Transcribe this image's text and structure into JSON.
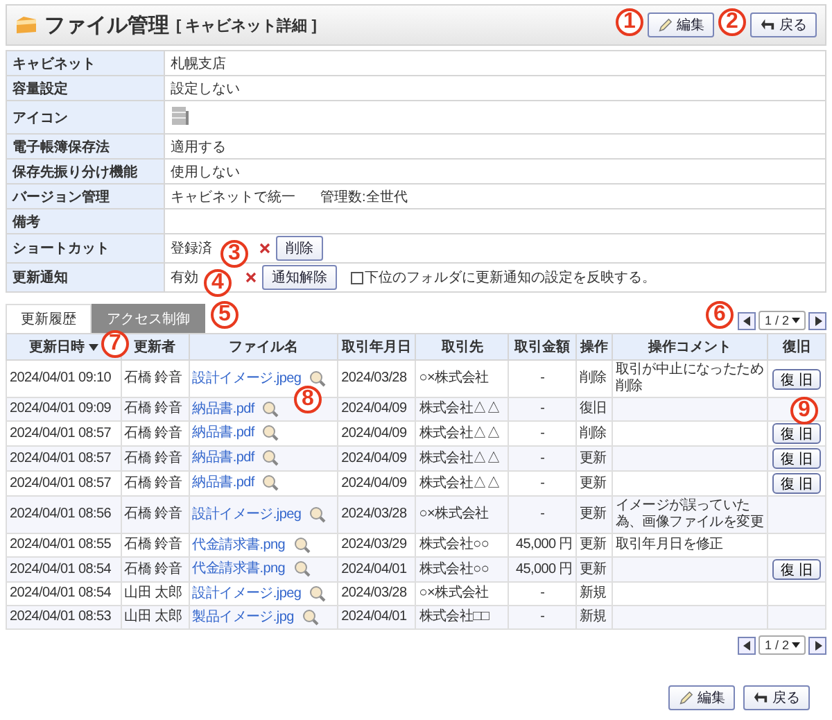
{
  "header": {
    "title": "ファイル管理",
    "subtitle": "[ キャビネット詳細 ]",
    "buttons": [
      {
        "kind": "edit",
        "label": "編集"
      },
      {
        "kind": "back",
        "label": "戻る"
      }
    ]
  },
  "details": [
    {
      "kind": "text",
      "label": "キャビネット",
      "value": "札幌支店"
    },
    {
      "kind": "text",
      "label": "容量設定",
      "value": "設定しない"
    },
    {
      "kind": "icon",
      "label": "アイコン"
    },
    {
      "kind": "text",
      "label": "電子帳簿保存法",
      "value": "適用する"
    },
    {
      "kind": "text",
      "label": "保存先振り分け機能",
      "value": "使用しない"
    },
    {
      "kind": "version",
      "label": "バージョン管理",
      "value": "キャビネットで統一",
      "extra": "管理数:全世代"
    },
    {
      "kind": "text",
      "label": "備考"
    },
    {
      "kind": "action",
      "label": "ショートカット",
      "value": "登録済",
      "button": "削除"
    },
    {
      "kind": "action",
      "label": "更新通知",
      "value": "有効",
      "button": "通知解除",
      "checkbox": {
        "label": "下位のフォルダに更新通知の設定を反映する。",
        "checked": false
      }
    }
  ],
  "tabs": [
    {
      "label": "更新履歴",
      "selected": true
    },
    {
      "label": "アクセス制御",
      "selected": false
    }
  ],
  "pager": {
    "page": "1 / 2"
  },
  "bottom_pager": {
    "page": "1 / 2"
  },
  "table": {
    "columns": [
      {
        "label": "更新日時",
        "sorted": true
      },
      {
        "label": "更新者",
        "sorted": false
      },
      {
        "label": "ファイル名",
        "sorted": false
      },
      {
        "label": "取引年月日",
        "sorted": false
      },
      {
        "label": "取引先",
        "sorted": false
      },
      {
        "label": "取引金額",
        "sorted": false
      },
      {
        "label": "操作",
        "sorted": false
      },
      {
        "label": "操作コメント",
        "sorted": false
      },
      {
        "label": "復旧",
        "sorted": false
      }
    ],
    "rows": [
      {
        "date": "2024/04/01 09:10",
        "user": "石橋 鈴音",
        "file": "設計イメージ.jpeg",
        "trade_date": "2024/03/28",
        "partner": "○×株式会社",
        "amount": "-",
        "op": "削除",
        "comment": "取引が中止になったため削除",
        "restore": "復 旧"
      },
      {
        "date": "2024/04/01 09:09",
        "user": "石橋 鈴音",
        "file": "納品書.pdf",
        "trade_date": "2024/04/09",
        "partner": "株式会社△△",
        "amount": "-",
        "op": "復旧"
      },
      {
        "date": "2024/04/01 08:57",
        "user": "石橋 鈴音",
        "file": "納品書.pdf",
        "trade_date": "2024/04/09",
        "partner": "株式会社△△",
        "amount": "-",
        "op": "削除",
        "restore": "復 旧"
      },
      {
        "date": "2024/04/01 08:57",
        "user": "石橋 鈴音",
        "file": "納品書.pdf",
        "trade_date": "2024/04/09",
        "partner": "株式会社△△",
        "amount": "-",
        "op": "更新",
        "restore": "復 旧"
      },
      {
        "date": "2024/04/01 08:57",
        "user": "石橋 鈴音",
        "file": "納品書.pdf",
        "trade_date": "2024/04/09",
        "partner": "株式会社△△",
        "amount": "-",
        "op": "更新",
        "restore": "復 旧"
      },
      {
        "date": "2024/04/01 08:56",
        "user": "石橋 鈴音",
        "file": "設計イメージ.jpeg",
        "trade_date": "2024/03/28",
        "partner": "○×株式会社",
        "amount": "-",
        "op": "更新",
        "comment": "イメージが誤っていた為、画像ファイルを変更"
      },
      {
        "date": "2024/04/01 08:55",
        "user": "石橋 鈴音",
        "file": "代金請求書.png",
        "trade_date": "2024/03/29",
        "partner": "株式会社○○",
        "amount": "45,000 円",
        "op": "更新",
        "comment": "取引年月日を修正"
      },
      {
        "date": "2024/04/01 08:54",
        "user": "石橋 鈴音",
        "file": "代金請求書.png",
        "trade_date": "2024/04/01",
        "partner": "株式会社○○",
        "amount": "45,000 円",
        "op": "更新",
        "restore": "復 旧"
      },
      {
        "date": "2024/04/01 08:54",
        "user": "山田 太郎",
        "file": "設計イメージ.jpeg",
        "trade_date": "2024/03/28",
        "partner": "○×株式会社",
        "amount": "-",
        "op": "新規"
      },
      {
        "date": "2024/04/01 08:53",
        "user": "山田 太郎",
        "file": "製品イメージ.jpg",
        "trade_date": "2024/04/01",
        "partner": "株式会社□□",
        "amount": "-",
        "op": "新規"
      }
    ]
  },
  "footer_buttons": [
    {
      "kind": "edit",
      "label": "編集"
    },
    {
      "kind": "back",
      "label": "戻る"
    }
  ],
  "callouts": [
    {
      "label": "1"
    },
    {
      "label": "2"
    },
    {
      "label": "3"
    },
    {
      "label": "4"
    },
    {
      "label": "5"
    },
    {
      "label": "6"
    },
    {
      "label": "7"
    },
    {
      "label": "8"
    },
    {
      "label": "9"
    }
  ]
}
